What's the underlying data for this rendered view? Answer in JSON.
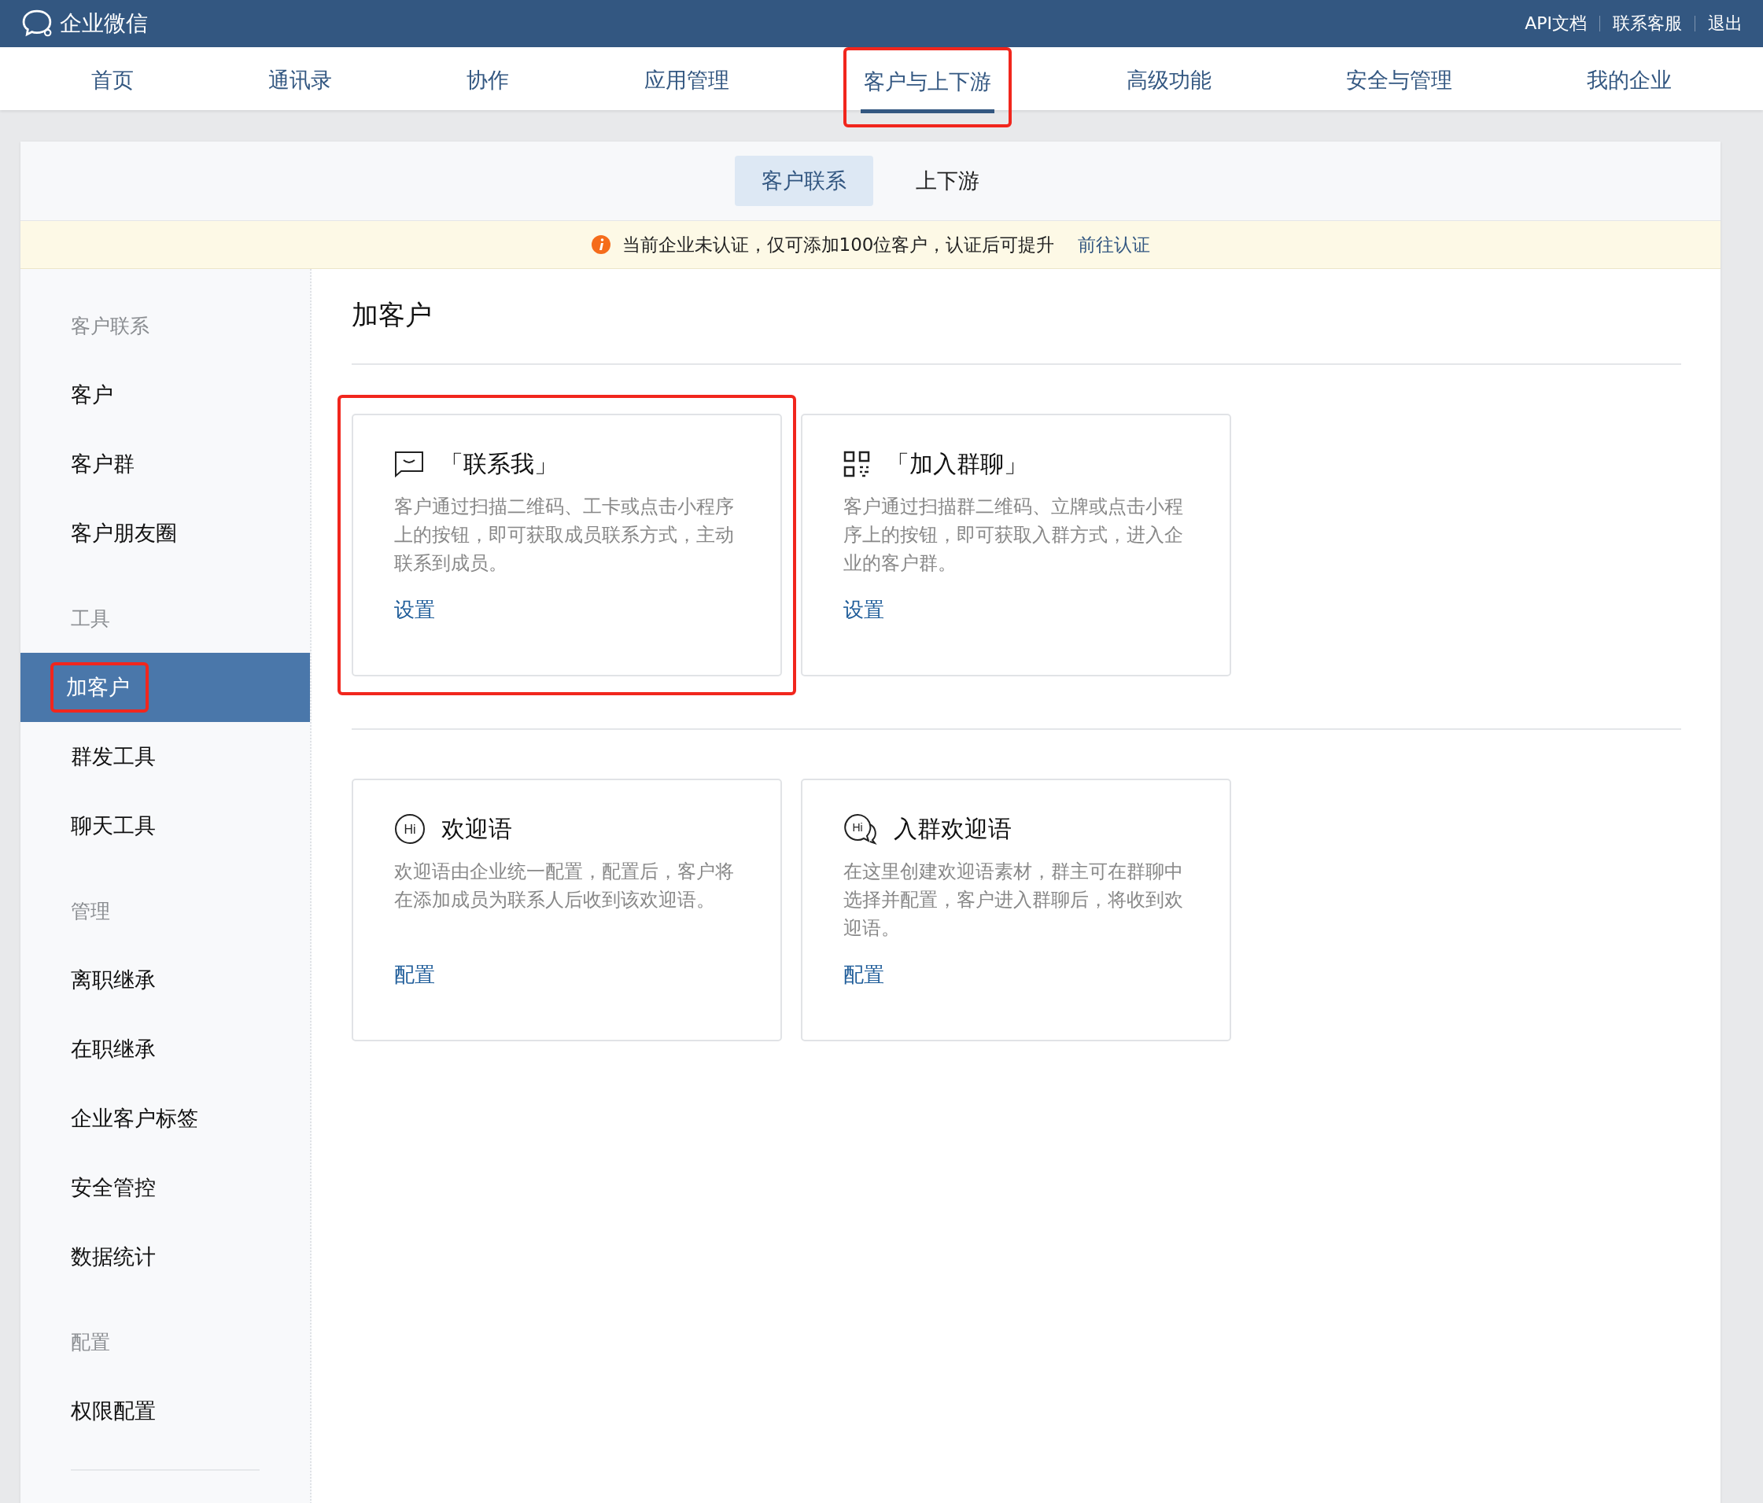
{
  "header": {
    "logo": "企业微信",
    "links": [
      "API文档",
      "联系客服",
      "退出"
    ]
  },
  "nav": [
    {
      "label": "首页",
      "selected": false,
      "highlighted": false
    },
    {
      "label": "通讯录",
      "selected": false,
      "highlighted": false
    },
    {
      "label": "协作",
      "selected": false,
      "highlighted": false
    },
    {
      "label": "应用管理",
      "selected": false,
      "highlighted": false
    },
    {
      "label": "客户与上下游",
      "selected": true,
      "highlighted": true
    },
    {
      "label": "高级功能",
      "selected": false,
      "highlighted": false
    },
    {
      "label": "安全与管理",
      "selected": false,
      "highlighted": false
    },
    {
      "label": "我的企业",
      "selected": false,
      "highlighted": false
    }
  ],
  "sub_tabs": [
    {
      "label": "客户联系",
      "selected": true
    },
    {
      "label": "上下游",
      "selected": false
    }
  ],
  "notice": {
    "text": "当前企业未认证，仅可添加100位客户，认证后可提升",
    "link": "前往认证"
  },
  "sidebar": [
    {
      "kind": "heading",
      "label": "客户联系"
    },
    {
      "kind": "item",
      "label": "客户",
      "selected": false,
      "highlighted": false
    },
    {
      "kind": "item",
      "label": "客户群",
      "selected": false,
      "highlighted": false
    },
    {
      "kind": "item",
      "label": "客户朋友圈",
      "selected": false,
      "highlighted": false
    },
    {
      "kind": "heading",
      "label": "工具"
    },
    {
      "kind": "item",
      "label": "加客户",
      "selected": true,
      "highlighted": true
    },
    {
      "kind": "item",
      "label": "群发工具",
      "selected": false,
      "highlighted": false
    },
    {
      "kind": "item",
      "label": "聊天工具",
      "selected": false,
      "highlighted": false
    },
    {
      "kind": "heading",
      "label": "管理"
    },
    {
      "kind": "item",
      "label": "离职继承",
      "selected": false,
      "highlighted": false
    },
    {
      "kind": "item",
      "label": "在职继承",
      "selected": false,
      "highlighted": false
    },
    {
      "kind": "item",
      "label": "企业客户标签",
      "selected": false,
      "highlighted": false
    },
    {
      "kind": "item",
      "label": "安全管控",
      "selected": false,
      "highlighted": false
    },
    {
      "kind": "item",
      "label": "数据统计",
      "selected": false,
      "highlighted": false
    },
    {
      "kind": "heading",
      "label": "配置"
    },
    {
      "kind": "item",
      "label": "权限配置",
      "selected": false,
      "highlighted": false
    },
    {
      "kind": "divider"
    }
  ],
  "page_title": "加客户",
  "card_groups": [
    [
      {
        "kind": "chat",
        "title": "「联系我」",
        "description": "客户通过扫描二维码、工卡或点击小程序上的按钮，即可获取成员联系方式，主动联系到成员。",
        "action": "设置",
        "highlighted": true
      },
      {
        "kind": "qr",
        "title": "「加入群聊」",
        "description": "客户通过扫描群二维码、立牌或点击小程序上的按钮，即可获取入群方式，进入企业的客户群。",
        "action": "设置",
        "highlighted": false
      }
    ],
    [
      {
        "kind": "hi",
        "icon_text": "Hi",
        "title": "欢迎语",
        "description": "欢迎语由企业统一配置，配置后，客户将在添加成员为联系人后收到该欢迎语。",
        "action": "配置",
        "highlighted": false
      },
      {
        "kind": "hi-group",
        "icon_text": "Hi",
        "title": "入群欢迎语",
        "description": "在这里创建欢迎语素材，群主可在群聊中选择并配置，客户进入群聊后，将收到欢迎语。",
        "action": "配置",
        "highlighted": false
      }
    ]
  ]
}
